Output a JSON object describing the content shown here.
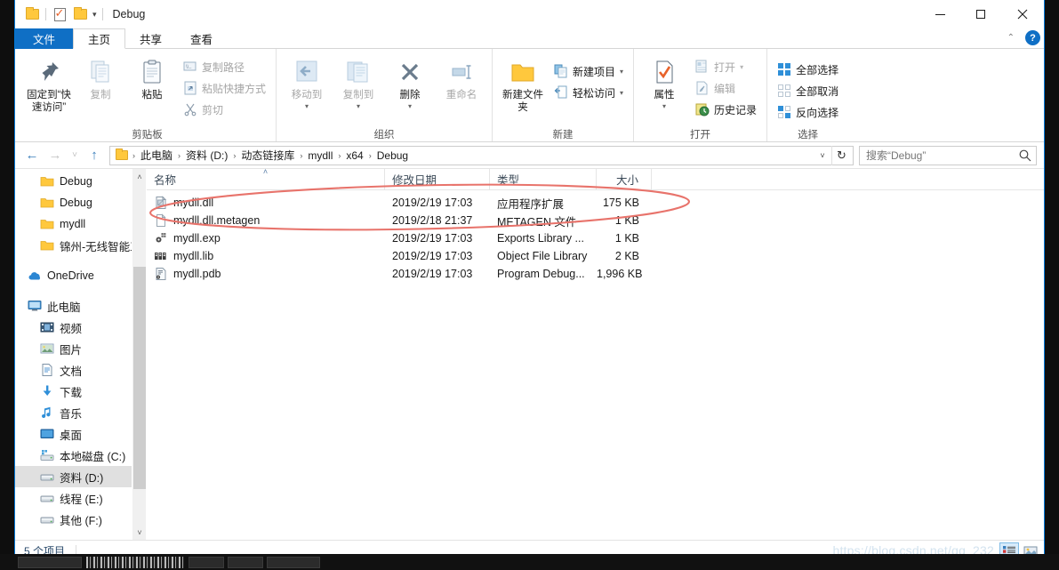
{
  "window": {
    "title": "Debug",
    "quick_access": [
      "folder-icon",
      "properties-icon",
      "folder-icon"
    ],
    "caption": {
      "minimize": "minimize-icon",
      "maximize": "maximize-icon",
      "close": "close-icon"
    },
    "ribbon_collapse": "⌃",
    "help": "?"
  },
  "tabs": [
    {
      "label": "文件",
      "type": "file"
    },
    {
      "label": "主页",
      "type": "active"
    },
    {
      "label": "共享",
      "type": "normal"
    },
    {
      "label": "查看",
      "type": "normal"
    }
  ],
  "ribbon": {
    "groups": [
      {
        "name": "clipboard",
        "label": "剪贴板",
        "big": [
          {
            "name": "pin-to-quick-access",
            "label": "固定到“快速访问”",
            "icon": "pin-icon",
            "dim": false
          },
          {
            "name": "copy",
            "label": "复制",
            "icon": "copy-icon",
            "dim": true
          },
          {
            "name": "paste",
            "label": "粘贴",
            "icon": "paste-icon",
            "dim": false
          }
        ],
        "small": [
          {
            "name": "copy-path",
            "label": "复制路径",
            "icon": "copy-path-icon",
            "dim": true
          },
          {
            "name": "paste-shortcut",
            "label": "粘贴快捷方式",
            "icon": "paste-shortcut-icon",
            "dim": true
          },
          {
            "name": "cut",
            "label": "剪切",
            "icon": "scissors-icon",
            "dim": true
          }
        ]
      },
      {
        "name": "organize",
        "label": "组织",
        "big": [
          {
            "name": "move-to",
            "label": "移动到",
            "icon": "move-to-icon",
            "dim": true,
            "caret": true
          },
          {
            "name": "copy-to",
            "label": "复制到",
            "icon": "copy-to-icon",
            "dim": true,
            "caret": true
          },
          {
            "name": "delete",
            "label": "删除",
            "icon": "delete-icon",
            "dim": false,
            "caret": true
          },
          {
            "name": "rename",
            "label": "重命名",
            "icon": "rename-icon",
            "dim": true
          }
        ]
      },
      {
        "name": "new",
        "label": "新建",
        "big": [
          {
            "name": "new-folder",
            "label": "新建文件夹",
            "icon": "new-folder-icon",
            "dim": false
          }
        ],
        "small": [
          {
            "name": "new-item",
            "label": "新建项目",
            "icon": "new-item-icon",
            "dim": false,
            "caret": true
          },
          {
            "name": "easy-access",
            "label": "轻松访问",
            "icon": "easy-access-icon",
            "dim": false,
            "caret": true
          }
        ]
      },
      {
        "name": "open",
        "label": "打开",
        "big": [
          {
            "name": "properties",
            "label": "属性",
            "icon": "properties-icon",
            "dim": false,
            "caret": true
          }
        ],
        "small": [
          {
            "name": "open",
            "label": "打开",
            "icon": "open-icon",
            "dim": true,
            "caret": true
          },
          {
            "name": "edit",
            "label": "编辑",
            "icon": "edit-icon",
            "dim": true
          },
          {
            "name": "history",
            "label": "历史记录",
            "icon": "history-icon",
            "dim": false
          }
        ]
      },
      {
        "name": "select",
        "label": "选择",
        "small": [
          {
            "name": "select-all",
            "label": "全部选择",
            "icon": "select-all-icon",
            "dim": false
          },
          {
            "name": "select-none",
            "label": "全部取消",
            "icon": "select-none-icon",
            "dim": false
          },
          {
            "name": "invert-selection",
            "label": "反向选择",
            "icon": "invert-selection-icon",
            "dim": false
          }
        ]
      }
    ]
  },
  "nav_toolbar": {
    "back": "←",
    "forward": "→",
    "recent": "˅",
    "up": "↑",
    "address_dropdown": "˅",
    "refresh": "↻"
  },
  "breadcrumb": {
    "icon": "folder-icon",
    "items": [
      "此电脑",
      "资料 (D:)",
      "动态链接库",
      "mydll",
      "x64",
      "Debug"
    ],
    "separator": "›"
  },
  "search": {
    "placeholder": "搜索“Debug”",
    "value": "",
    "icon": "search-icon"
  },
  "nav_pane": {
    "items": [
      {
        "label": "Debug",
        "icon": "folder-icon",
        "indent": 2,
        "selected": false
      },
      {
        "label": "Debug",
        "icon": "folder-icon",
        "indent": 2,
        "selected": false
      },
      {
        "label": "mydll",
        "icon": "folder-icon",
        "indent": 2,
        "selected": false
      },
      {
        "label": "锦州-无线智能工",
        "icon": "folder-icon",
        "indent": 2,
        "selected": false
      },
      {
        "label": "",
        "icon": "spacer",
        "indent": 0,
        "selected": false
      },
      {
        "label": "OneDrive",
        "icon": "onedrive-icon",
        "indent": 1,
        "selected": false
      },
      {
        "label": "",
        "icon": "spacer",
        "indent": 0,
        "selected": false
      },
      {
        "label": "此电脑",
        "icon": "this-pc-icon",
        "indent": 1,
        "selected": false
      },
      {
        "label": "视频",
        "icon": "videos-icon",
        "indent": 2,
        "selected": false
      },
      {
        "label": "图片",
        "icon": "pictures-icon",
        "indent": 2,
        "selected": false
      },
      {
        "label": "文档",
        "icon": "documents-icon",
        "indent": 2,
        "selected": false
      },
      {
        "label": "下载",
        "icon": "downloads-icon",
        "indent": 2,
        "selected": false
      },
      {
        "label": "音乐",
        "icon": "music-icon",
        "indent": 2,
        "selected": false
      },
      {
        "label": "桌面",
        "icon": "desktop-icon",
        "indent": 2,
        "selected": false
      },
      {
        "label": "本地磁盘 (C:)",
        "icon": "system-drive-icon",
        "indent": 2,
        "selected": false
      },
      {
        "label": "资料 (D:)",
        "icon": "drive-icon",
        "indent": 2,
        "selected": true
      },
      {
        "label": "线程 (E:)",
        "icon": "drive-icon",
        "indent": 2,
        "selected": false
      },
      {
        "label": "其他 (F:)",
        "icon": "drive-icon",
        "indent": 2,
        "selected": false
      }
    ],
    "scroll_up": "˄",
    "scroll_down": "˅"
  },
  "file_list": {
    "columns": [
      {
        "key": "name",
        "label": "名称",
        "sorted": true,
        "sort_dir": "asc"
      },
      {
        "key": "date",
        "label": "修改日期",
        "sorted": false
      },
      {
        "key": "type",
        "label": "类型",
        "sorted": false
      },
      {
        "key": "size",
        "label": "大小",
        "sorted": false
      }
    ],
    "rows": [
      {
        "name": "mydll.dll",
        "icon": "dll-file-icon",
        "date": "2019/2/19 17:03",
        "type": "应用程序扩展",
        "size": "175 KB"
      },
      {
        "name": "mydll.dll.metagen",
        "icon": "generic-file-icon",
        "date": "2019/2/18 21:37",
        "type": "METAGEN 文件",
        "size": "1 KB"
      },
      {
        "name": "mydll.exp",
        "icon": "exp-file-icon",
        "date": "2019/2/19 17:03",
        "type": "Exports Library ...",
        "size": "1 KB"
      },
      {
        "name": "mydll.lib",
        "icon": "lib-file-icon",
        "date": "2019/2/19 17:03",
        "type": "Object File Library",
        "size": "2 KB"
      },
      {
        "name": "mydll.pdb",
        "icon": "pdb-file-icon",
        "date": "2019/2/19 17:03",
        "type": "Program Debug...",
        "size": "1,996 KB"
      }
    ]
  },
  "annotation": {
    "shape": "ellipse",
    "color": "#e8736b",
    "target_row": "mydll.dll"
  },
  "status_bar": {
    "count": "5 个项目",
    "watermark": "https://blog.csdn.net/qq_232",
    "views": [
      {
        "name": "details-view",
        "active": true
      },
      {
        "name": "large-icons-view",
        "active": false
      }
    ]
  },
  "colors": {
    "accent": "#0f6fc5",
    "folder": "#ffc83d",
    "selection": "#e0e0e0",
    "annotation": "#e8736b"
  }
}
